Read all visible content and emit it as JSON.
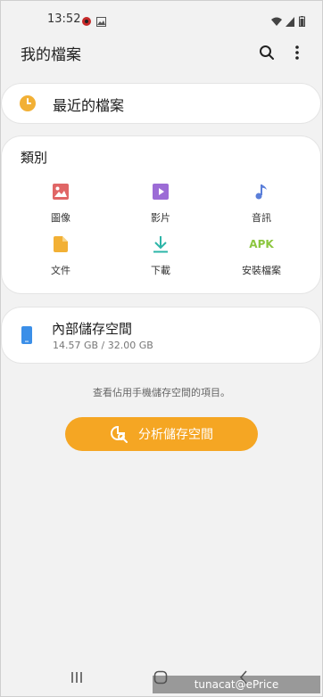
{
  "status_bar": {
    "time": "13:52"
  },
  "app_bar": {
    "title": "我的檔案"
  },
  "recent": {
    "label": "最近的檔案"
  },
  "categories": {
    "heading": "類別",
    "items": [
      {
        "label": "圖像",
        "icon": "image-icon",
        "color": "#e06666"
      },
      {
        "label": "影片",
        "icon": "video-icon",
        "color": "#9c6cd6"
      },
      {
        "label": "音訊",
        "icon": "audio-icon",
        "color": "#5b7fd9"
      },
      {
        "label": "文件",
        "icon": "document-icon",
        "color": "#f2b035"
      },
      {
        "label": "下載",
        "icon": "download-icon",
        "color": "#2cb5a8"
      },
      {
        "label": "安裝檔案",
        "icon": "apk-icon",
        "icon_text": "APK",
        "color": "#8cc63f"
      }
    ]
  },
  "storage": {
    "title": "內部儲存空間",
    "usage": "14.57 GB / 32.00 GB"
  },
  "hint": "查看佔用手機儲存空間的項目。",
  "analyze_button": {
    "label": "分析儲存空間"
  },
  "watermark": "tunacat@ePrice",
  "colors": {
    "accent": "#f5a623",
    "background": "#f2f2f2",
    "card": "#ffffff"
  }
}
